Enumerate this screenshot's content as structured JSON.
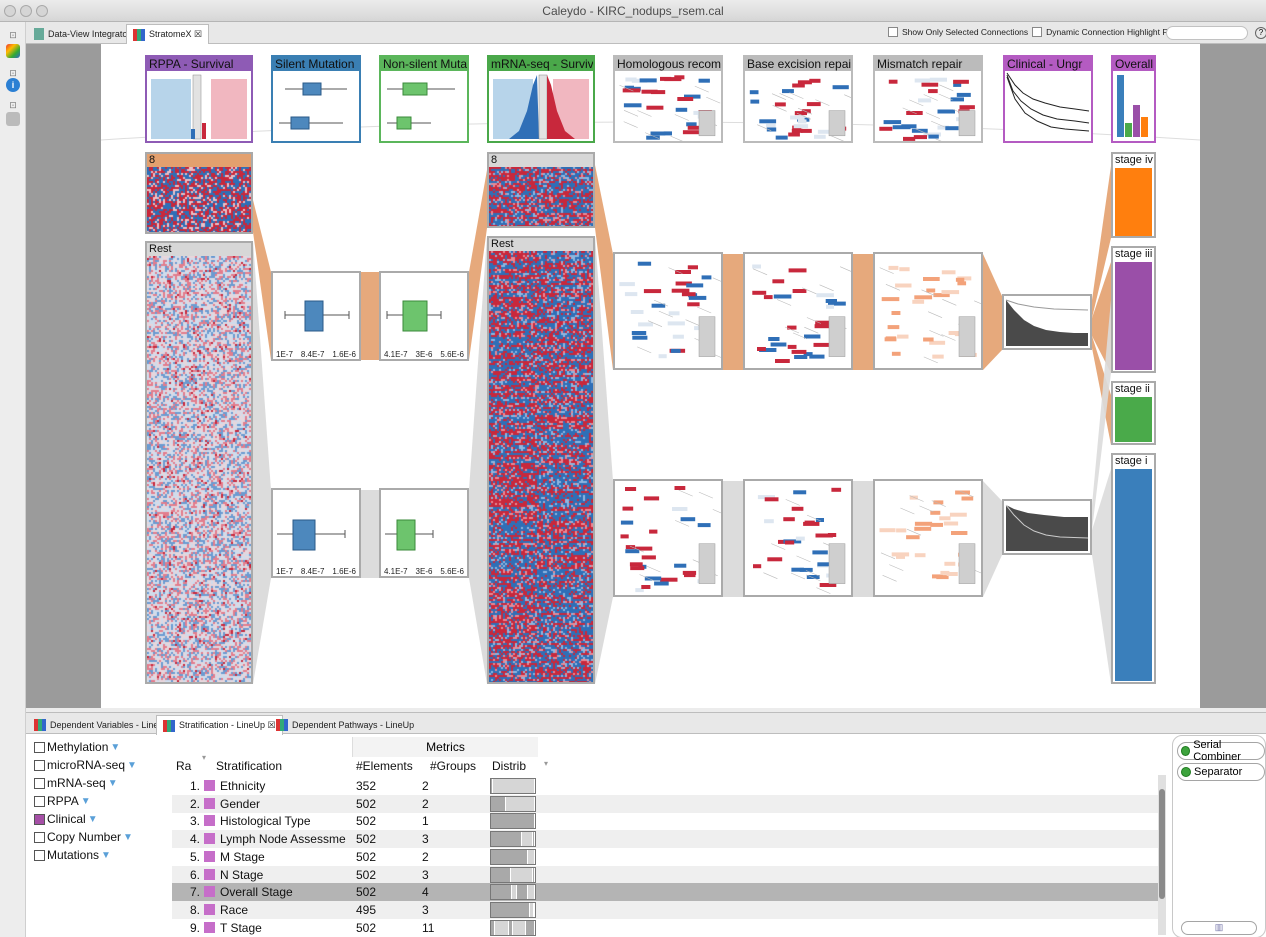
{
  "window": {
    "title": "Caleydo - KIRC_nodups_rsem.cal"
  },
  "tabs": [
    {
      "label": "Data-View Integrator"
    },
    {
      "label": "StratomeX ☒"
    }
  ],
  "toolbar": {
    "show_selected": "Show Only Selected Connections",
    "dynamic_highlight": "Dynamic Connection Highlight Focus"
  },
  "headers": [
    {
      "label": "RPPA - Survival",
      "color": "#8e5bb5"
    },
    {
      "label": "Silent Mutation",
      "color": "#3a7fb3"
    },
    {
      "label": "Non-silent Muta",
      "color": "#5bb65b"
    },
    {
      "label": "mRNA-seq - Survival",
      "color": "#4aa84a"
    },
    {
      "label": "Homologous recom",
      "color": "#bbbbbb"
    },
    {
      "label": "Base excision repai",
      "color": "#bbbbbb"
    },
    {
      "label": "Mismatch repair",
      "color": "#bbbbbb"
    },
    {
      "label": "Clinical - Ungr",
      "color": "#b45bc2"
    },
    {
      "label": "Overall",
      "color": "#b45bc2"
    }
  ],
  "blocks": {
    "rppa_8": "8",
    "rppa_rest": "Rest",
    "mrna_8": "8",
    "mrna_rest": "Rest",
    "stage_iv": "stage iv",
    "stage_iii": "stage iii",
    "stage_ii": "stage ii",
    "stage_i": "stage i"
  },
  "boxplot_axis": {
    "silent": [
      "1E-7",
      "8.4E-7",
      "1.6E-6"
    ],
    "nonsilent": [
      "4.1E-7",
      "3E-6",
      "5.6E-6"
    ],
    "silent_top": [
      "1E-7",
      "8.4E-7",
      "1.6E-6"
    ],
    "nonsilent_top": [
      "4.1E-7",
      "3E-6",
      "5.6E-6"
    ]
  },
  "colors": {
    "stage_iv": "#ff7f0e",
    "stage_iii": "#9a4fa8",
    "stage_ii": "#4aaa4a",
    "stage_i": "#3a7fbb",
    "connection_orange": "#e3a06e",
    "heat_red": "#c8283c",
    "heat_blue": "#2f6fb7"
  },
  "bottom_tabs": [
    {
      "label": "Dependent Variables - LineUp"
    },
    {
      "label": "Stratification - LineUp ☒"
    },
    {
      "label": "Dependent Pathways - LineUp"
    }
  ],
  "datasets": [
    {
      "label": "Methylation",
      "checked": false
    },
    {
      "label": "microRNA-seq",
      "checked": false
    },
    {
      "label": "mRNA-seq",
      "checked": false
    },
    {
      "label": "RPPA",
      "checked": false
    },
    {
      "label": "Clinical",
      "checked": true
    },
    {
      "label": "Copy Number",
      "checked": false
    },
    {
      "label": "Mutations",
      "checked": false
    }
  ],
  "lineup": {
    "metrics_header": "Metrics",
    "col_rank": "Ra",
    "col_strat": "Stratification",
    "col_elements": "#Elements",
    "col_groups": "#Groups",
    "col_distrib": "Distrib",
    "rows": [
      {
        "rank": "1.",
        "name": "Ethnicity",
        "elements": "352",
        "groups": "2",
        "distrib": [
          0.05,
          0.95
        ]
      },
      {
        "rank": "2.",
        "name": "Gender",
        "elements": "502",
        "groups": "2",
        "distrib": [
          0.35,
          0.65
        ]
      },
      {
        "rank": "3.",
        "name": "Histological Type",
        "elements": "502",
        "groups": "1",
        "distrib": [
          1.0
        ]
      },
      {
        "rank": "4.",
        "name": "Lymph Node Assessme",
        "elements": "502",
        "groups": "3",
        "distrib": [
          0.7,
          0.25,
          0.05
        ]
      },
      {
        "rank": "5.",
        "name": "M Stage",
        "elements": "502",
        "groups": "2",
        "distrib": [
          0.85,
          0.15
        ]
      },
      {
        "rank": "6.",
        "name": "N Stage",
        "elements": "502",
        "groups": "3",
        "distrib": [
          0.45,
          0.5,
          0.05
        ]
      },
      {
        "rank": "7.",
        "name": "Overall Stage",
        "elements": "502",
        "groups": "4",
        "distrib": [
          0.48,
          0.1,
          0.25,
          0.17
        ]
      },
      {
        "rank": "8.",
        "name": "Race",
        "elements": "495",
        "groups": "3",
        "distrib": [
          0.88,
          0.1,
          0.02
        ]
      },
      {
        "rank": "9.",
        "name": "T Stage",
        "elements": "502",
        "groups": "11",
        "distrib": [
          0.1,
          0.3,
          0.1,
          0.3,
          0.2
        ]
      }
    ]
  },
  "right_panel": {
    "serial": "Serial Combiner",
    "separator": "Separator"
  }
}
